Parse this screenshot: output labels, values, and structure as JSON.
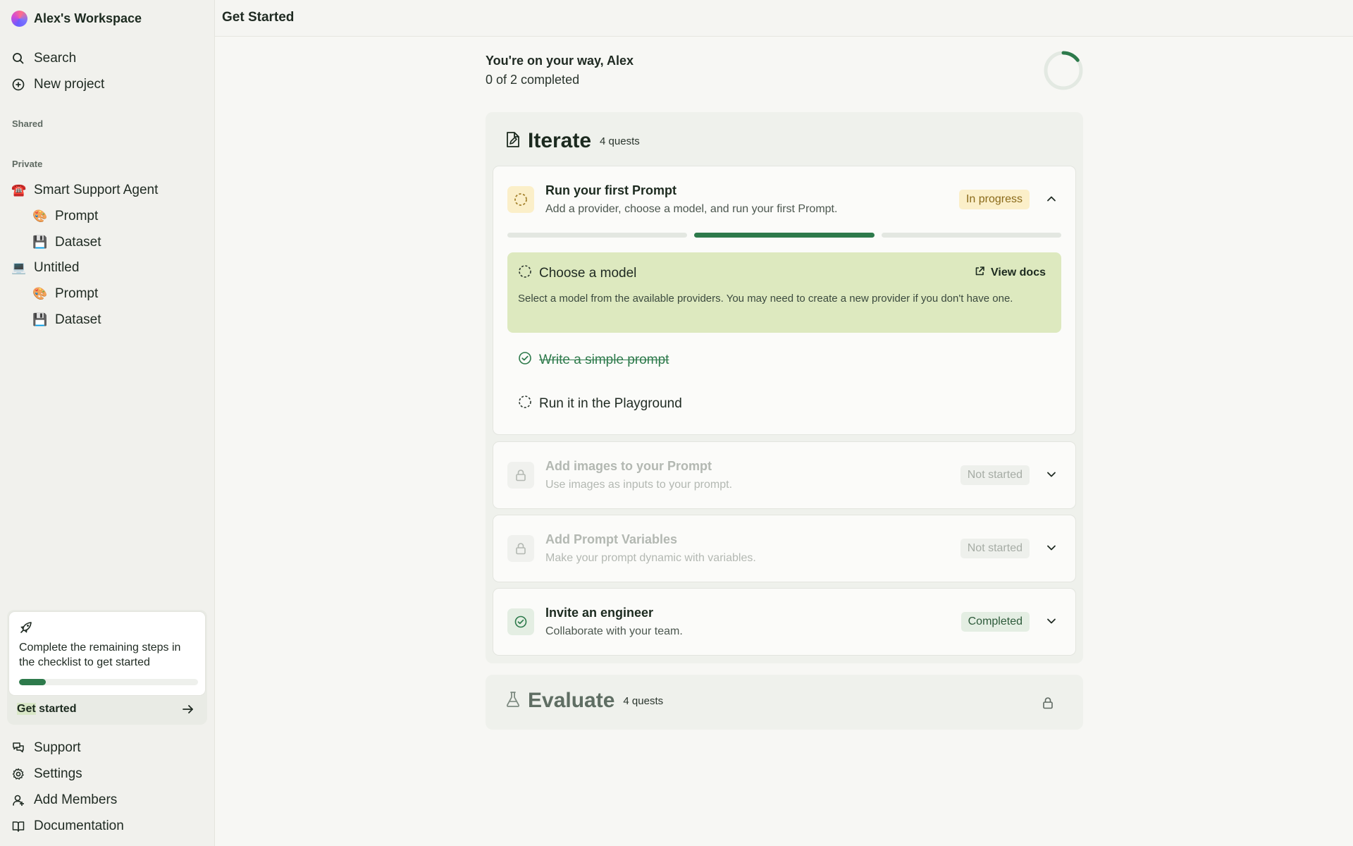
{
  "workspace": {
    "name": "Alex's Workspace"
  },
  "sidebar": {
    "search_label": "Search",
    "new_project_label": "New project",
    "shared_label": "Shared",
    "private_label": "Private",
    "projects": [
      {
        "name": "Smart Support Agent",
        "icon": "telephone-emoji",
        "children": [
          {
            "label": "Prompt",
            "icon": "palette-emoji"
          },
          {
            "label": "Dataset",
            "icon": "floppy-disk-emoji"
          }
        ]
      },
      {
        "name": "Untitled",
        "icon": "computer-emoji",
        "children": [
          {
            "label": "Prompt",
            "icon": "palette-emoji"
          },
          {
            "label": "Dataset",
            "icon": "floppy-disk-emoji"
          }
        ]
      }
    ],
    "promo": {
      "text": "Complete the remaining steps in the checklist to get started",
      "progress": 0.15,
      "cta_hl": "Get",
      "cta_rest": " started"
    },
    "footer": [
      {
        "label": "Support",
        "icon": "chat-icon"
      },
      {
        "label": "Settings",
        "icon": "gear-icon"
      },
      {
        "label": "Add Members",
        "icon": "user-icon"
      },
      {
        "label": "Documentation",
        "icon": "book-icon"
      }
    ]
  },
  "header": {
    "title": "Get Started"
  },
  "main": {
    "greeting": "You're on your way, Alex",
    "progress_text": "0 of 2 completed",
    "progress_fraction": 0.15,
    "groups": [
      {
        "title": "Iterate",
        "count": "4 quests",
        "quests": [
          {
            "title": "Run your first Prompt",
            "desc": "Add a provider, choose a model, and run your first Prompt.",
            "status": "In progress",
            "steps": [
              {
                "label": "Choose a model",
                "state": "active",
                "desc": "Select a model from the available providers. You may need to create a new provider if you don't have one.",
                "link": "View docs"
              },
              {
                "label": "Write a simple prompt",
                "state": "done"
              },
              {
                "label": "Run it in the Playground",
                "state": "todo"
              }
            ],
            "segments": [
              false,
              true,
              false
            ]
          },
          {
            "title": "Add images to your Prompt",
            "desc": "Use images as inputs to your prompt.",
            "status": "Not started"
          },
          {
            "title": "Add Prompt Variables",
            "desc": "Make your prompt dynamic with variables.",
            "status": "Not started"
          },
          {
            "title": "Invite an engineer",
            "desc": "Collaborate with your team.",
            "status": "Completed"
          }
        ]
      },
      {
        "title": "Evaluate",
        "count": "4 quests",
        "locked": true
      }
    ]
  },
  "colors": {
    "accent": "#2d7a4b",
    "in_progress_bg": "#fbefc9",
    "in_progress_fg": "#8a6a1a",
    "active_step_bg": "#dde9bf",
    "completed_bg": "#e4eee3"
  }
}
